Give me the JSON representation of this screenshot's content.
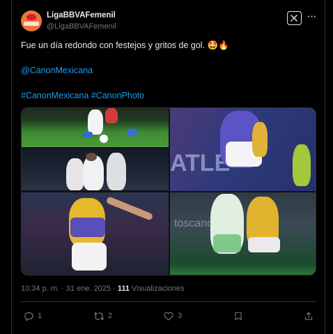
{
  "author": {
    "name": "LigaBBVAFemenil",
    "handle": "@LigaBBVAFemenil"
  },
  "tweet": {
    "text": "Fue un día redondo con festejos y gritos de gol. 🤩🔥",
    "mention": "@CanonMexicana",
    "hashtags": "#CanonMexicana #CanonPhoto"
  },
  "meta": {
    "time_date": "10:34 p. m. · 31 ene. 2025 · ",
    "views_count": "111",
    "views_label": " Visualizaciones"
  },
  "actions": {
    "replies": "1",
    "retweets": "2",
    "likes": "3"
  },
  "colors": {
    "background": "#000000",
    "text": "#e7e9ea",
    "muted": "#71767b",
    "link": "#1d9bf0",
    "border": "#2f3336"
  },
  "icons": [
    "grok-icon",
    "more-icon",
    "reply-icon",
    "retweet-icon",
    "like-icon",
    "bookmark-icon",
    "share-icon"
  ]
}
